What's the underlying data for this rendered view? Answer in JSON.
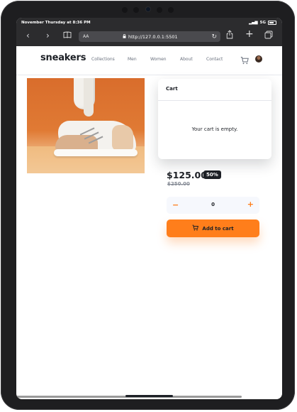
{
  "status_bar": {
    "time_date": "November Thursday at 8:36 PM",
    "network": "5G"
  },
  "browser": {
    "text_size_label": "AA",
    "url": "http://127.0.0.1:5501",
    "icons": [
      "back-icon",
      "forward-icon",
      "book-icon",
      "lock-icon",
      "reload-icon",
      "share-icon",
      "new-tab-icon",
      "tabs-icon"
    ]
  },
  "site": {
    "logo": "sneakers",
    "nav": [
      "Collections",
      "Men",
      "Women",
      "About",
      "Contact"
    ]
  },
  "cart": {
    "title": "Cart",
    "empty_message": "Your cart is empty."
  },
  "product": {
    "price": "$125.00",
    "discount": "50%",
    "original_price": "$250.00",
    "quantity": "0",
    "minus_label": "−",
    "plus_label": "+",
    "add_to_cart_label": "Add to cart"
  },
  "colors": {
    "accent": "#ff7e1b",
    "dark": "#1d2026",
    "muted": "#69707d"
  }
}
